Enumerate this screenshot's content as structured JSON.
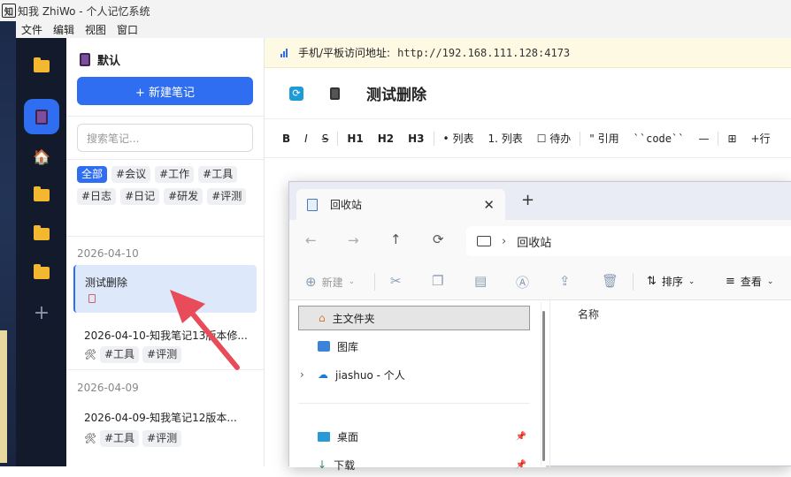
{
  "app": {
    "title": "知我 ZhiWo - 个人记忆系统",
    "logo_text": "知"
  },
  "menubar": [
    "文件",
    "编辑",
    "视图",
    "窗口"
  ],
  "sidebar": {
    "notebook_title": "默认",
    "new_note_label": "+ 新建笔记",
    "search_placeholder": "搜索笔记...",
    "tags": [
      "全部",
      "#会议",
      "#工作",
      "#工具",
      "#日志",
      "#日记",
      "#研发",
      "#评测"
    ],
    "groups": [
      {
        "date": "2026-04-10",
        "notes": [
          {
            "title": "测试删除",
            "tags": []
          },
          {
            "title": "2026-04-10-知我笔记13版本修...",
            "tags": [
              "#工具",
              "#评测"
            ]
          }
        ]
      },
      {
        "date": "2026-04-09",
        "notes": [
          {
            "title": "2026-04-09-知我笔记12版本...",
            "tags": [
              "#工具",
              "#评测"
            ]
          }
        ]
      }
    ]
  },
  "editor": {
    "banner_label": "手机/平板访问地址:",
    "banner_url": "http://192.168.111.128:4173",
    "note_title": "测试删除",
    "toolbar": [
      "B",
      "I",
      "S",
      "H1",
      "H2",
      "H3",
      "• 列表",
      "1. 列表",
      "☐ 待办",
      "\" 引用",
      "``code``",
      "—",
      "⊞",
      "+行"
    ]
  },
  "explorer": {
    "tab_title": "回收站",
    "address": "回收站",
    "commands": {
      "new": "新建",
      "sort": "排序",
      "view": "查看"
    },
    "nav_items": [
      "主文件夹",
      "图库",
      "jiashuo - 个人",
      "桌面",
      "下载"
    ],
    "column_name": "名称"
  },
  "colors": {
    "accent": "#2f6ef0",
    "rail_bg": "#121a2b",
    "banner_bg": "#fdf9e3",
    "arrow": "#e84c5a"
  }
}
